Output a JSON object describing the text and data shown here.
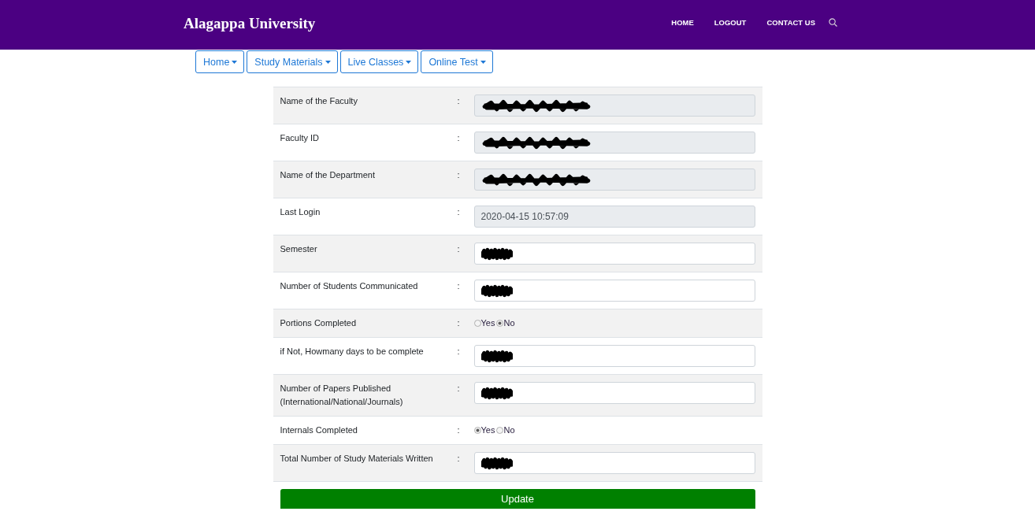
{
  "header": {
    "brand": "Alagappa University",
    "nav": [
      {
        "label": "HOME"
      },
      {
        "label": "LOGOUT"
      },
      {
        "label": "CONTACT US"
      }
    ]
  },
  "menu": [
    {
      "label": "Home"
    },
    {
      "label": "Study Materials"
    },
    {
      "label": "Live Classes"
    },
    {
      "label": "Online Test"
    }
  ],
  "form": {
    "rows": [
      {
        "kind": "text",
        "label": "Name of the Faculty",
        "separator": ":",
        "readonly": true,
        "redacted": true
      },
      {
        "kind": "text",
        "label": "Faculty ID",
        "separator": ":",
        "readonly": true,
        "redacted": true
      },
      {
        "kind": "text",
        "label": "Name of the Department",
        "separator": ":",
        "readonly": true,
        "redacted": true
      },
      {
        "kind": "text",
        "label": "Last Login",
        "separator": ":",
        "readonly": true,
        "value": "2020-04-15 10:57:09"
      },
      {
        "kind": "text",
        "label": "Semester",
        "separator": ":",
        "readonly": false,
        "redacted": true
      },
      {
        "kind": "text",
        "label": "Number of Students Communicated",
        "separator": ":",
        "readonly": false,
        "redacted": true
      },
      {
        "kind": "radio",
        "label": "Portions Completed",
        "separator": ":",
        "options": [
          {
            "label": "Yes",
            "selected": false
          },
          {
            "label": "No",
            "selected": true
          }
        ]
      },
      {
        "kind": "text",
        "label": "if Not, Howmany days to be complete",
        "separator": ":",
        "readonly": false,
        "redacted": true
      },
      {
        "kind": "text",
        "label": "Number of Papers Published (International/National/Journals)",
        "separator": ":",
        "readonly": false,
        "redacted": true
      },
      {
        "kind": "radio",
        "label": "Internals Completed",
        "separator": ":",
        "options": [
          {
            "label": "Yes",
            "selected": true
          },
          {
            "label": "No",
            "selected": false
          }
        ]
      },
      {
        "kind": "text",
        "label": "Total Number of Study Materials Written",
        "separator": ":",
        "readonly": false,
        "redacted": true
      }
    ],
    "submit": "Update"
  }
}
